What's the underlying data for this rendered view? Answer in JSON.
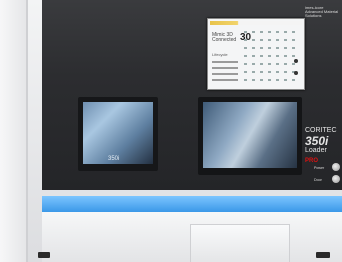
{
  "photo": {
    "brand_logo": "imes-icore",
    "brand_tagline": "Advanced Material Solutions",
    "screen": {
      "title_small": "Connected",
      "title_big": "30",
      "title_prefix": "Mimic 3D",
      "label_left": "Lifecycle"
    },
    "window_label": "350i",
    "model": {
      "line1": "CORITEC",
      "line2": "350i",
      "line3": "Loader",
      "line4": "PRO"
    },
    "controls": {
      "label1": "Power",
      "label2": "Door"
    }
  }
}
